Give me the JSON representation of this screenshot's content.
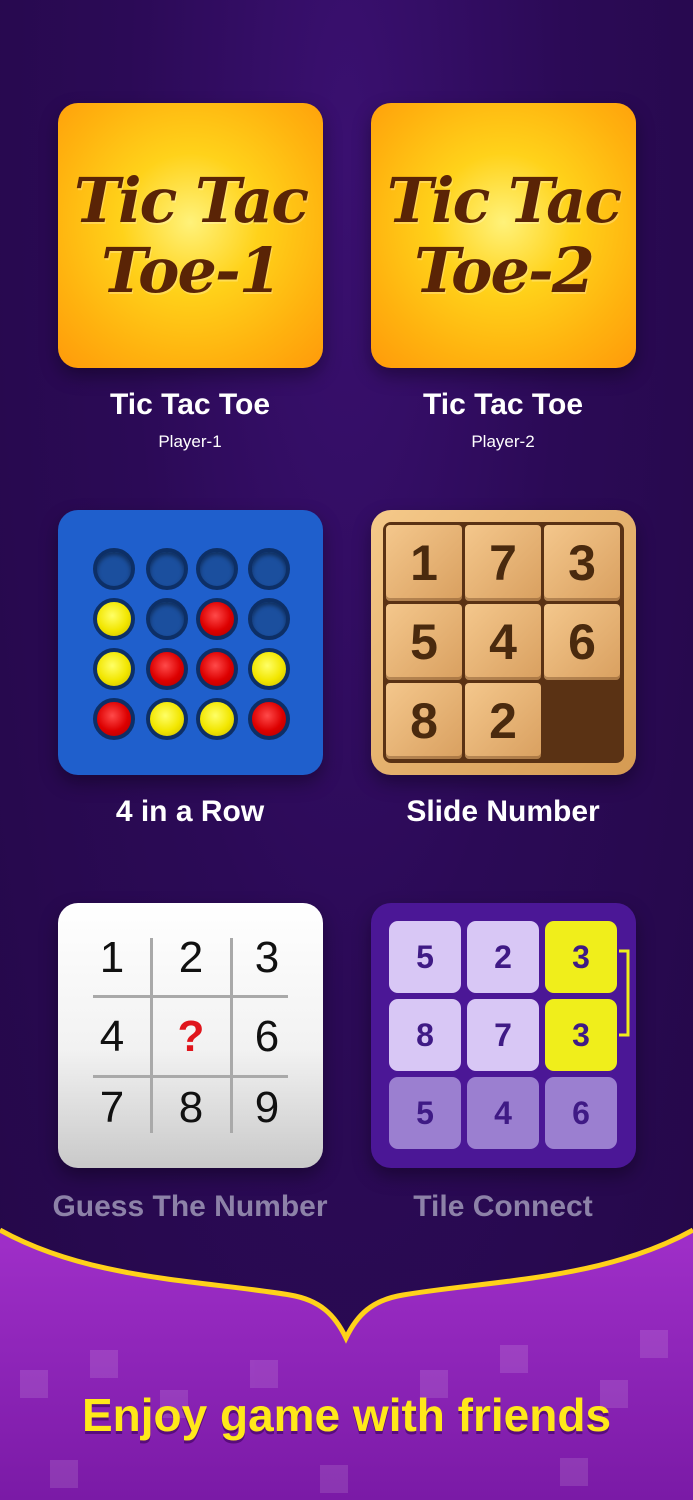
{
  "games": [
    {
      "art_lines": [
        "Tic Tac",
        "Toe-1"
      ],
      "title": "Tic Tac Toe",
      "subtitle": "Player-1"
    },
    {
      "art_lines": [
        "Tic Tac",
        "Toe-2"
      ],
      "title": "Tic Tac Toe",
      "subtitle": "Player-2"
    },
    {
      "title": "4 in a Row",
      "board": [
        [
          "empty",
          "empty",
          "empty",
          "empty"
        ],
        [
          "yellow",
          "empty",
          "red",
          "empty"
        ],
        [
          "yellow",
          "red",
          "red",
          "yellow"
        ],
        [
          "red",
          "yellow",
          "yellow",
          "red"
        ]
      ]
    },
    {
      "title": "Slide Number",
      "tiles": [
        "1",
        "7",
        "3",
        "5",
        "4",
        "6",
        "8",
        "2",
        ""
      ]
    },
    {
      "title": "Guess The Number",
      "cells": [
        "1",
        "2",
        "3",
        "4",
        "?",
        "6",
        "7",
        "8",
        "9"
      ]
    },
    {
      "title": "Tile Connect",
      "cells": [
        "5",
        "2",
        "3",
        "8",
        "7",
        "3",
        "5",
        "4",
        "6"
      ]
    }
  ],
  "promo_text": "Enjoy game with friends",
  "colors": {
    "background": "#2b0a56",
    "promo_yellow": "#ffe81a",
    "highlight": "#f0ee1b"
  }
}
